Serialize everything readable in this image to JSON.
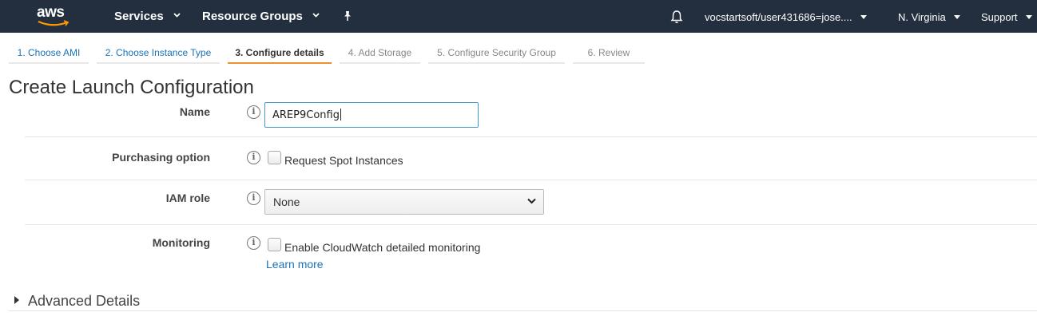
{
  "nav": {
    "logo_text": "aws",
    "services": "Services",
    "resource_groups": "Resource Groups",
    "account": "vocstartsoft/user431686=jose....",
    "region": "N. Virginia",
    "support": "Support"
  },
  "steps": [
    {
      "label": "1. Choose AMI",
      "state": "done"
    },
    {
      "label": "2. Choose Instance Type",
      "state": "done"
    },
    {
      "label": "3. Configure details",
      "state": "current"
    },
    {
      "label": "4. Add Storage",
      "state": "future"
    },
    {
      "label": "5. Configure Security Group",
      "state": "future"
    },
    {
      "label": "6. Review",
      "state": "future"
    }
  ],
  "page": {
    "title": "Create Launch Configuration"
  },
  "form": {
    "name_label": "Name",
    "name_value": "AREP9Config",
    "purchasing_label": "Purchasing option",
    "spot_label": "Request Spot Instances",
    "iam_label": "IAM role",
    "iam_value": "None",
    "monitoring_label": "Monitoring",
    "monitoring_checkbox_label": "Enable CloudWatch detailed monitoring",
    "learn_more": "Learn more",
    "info_glyph": "i"
  },
  "advanced": {
    "label": "Advanced Details"
  },
  "colors": {
    "nav_bg": "#232f3e",
    "link": "#1a73b8",
    "active_step": "#ec912d",
    "focus_border": "#3d9ad1"
  }
}
